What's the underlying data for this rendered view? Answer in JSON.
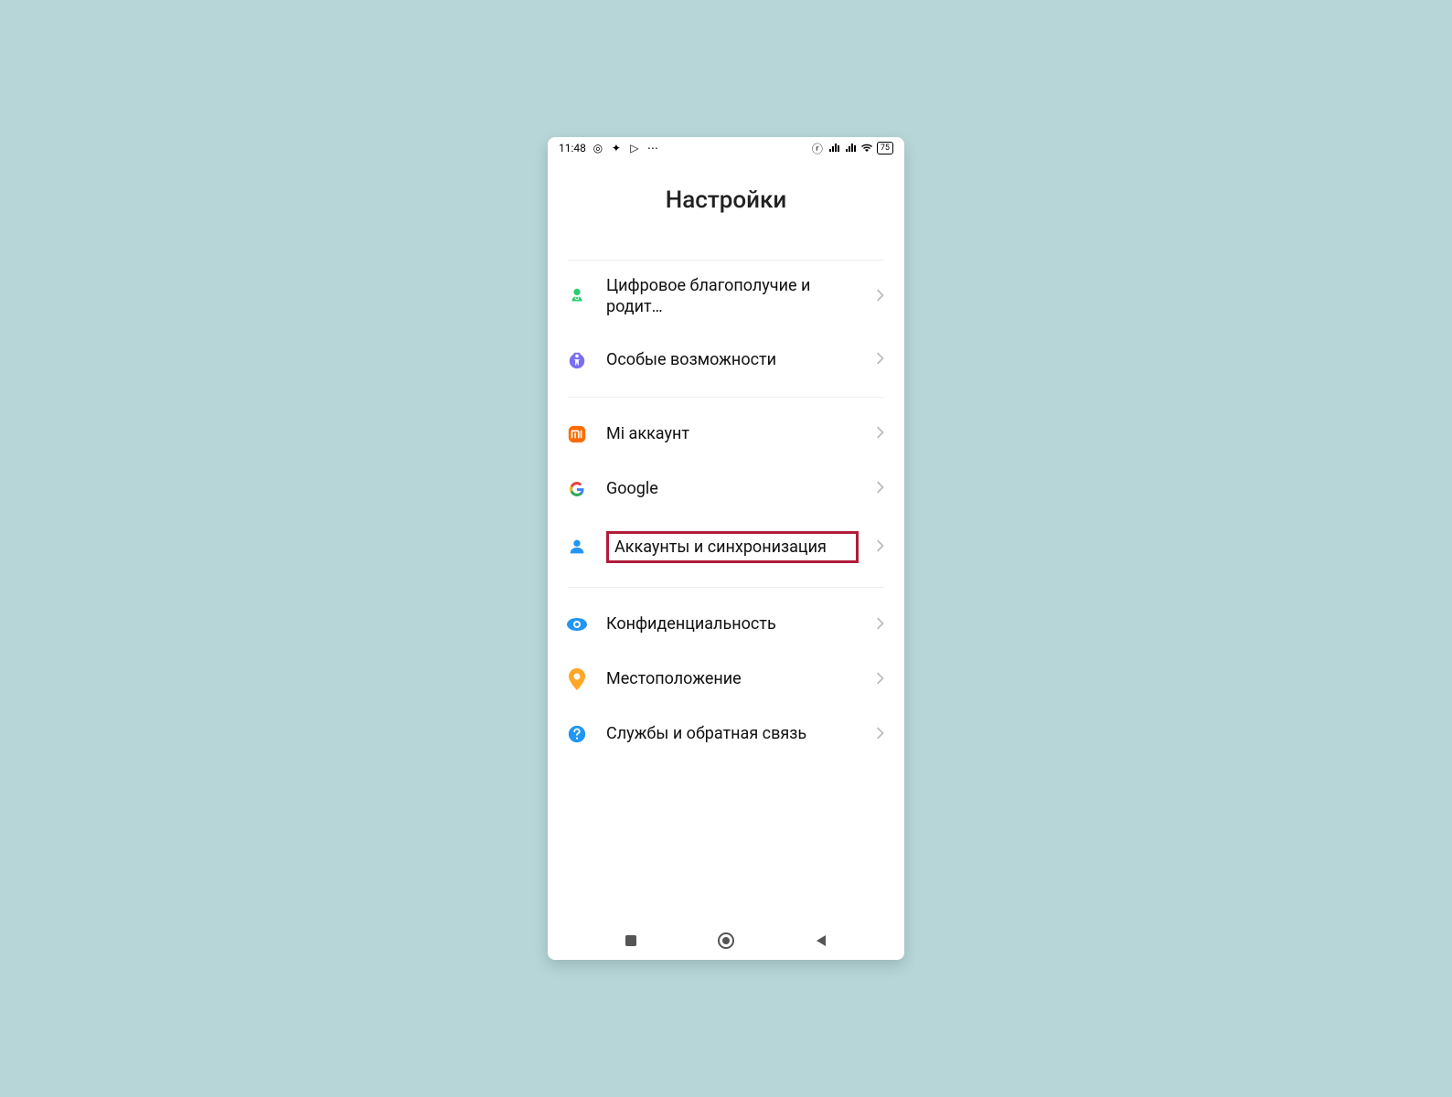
{
  "status": {
    "time": "11:48",
    "battery": "75"
  },
  "title": "Настройки",
  "groups": [
    {
      "items": [
        {
          "id": "wellbeing",
          "label": "Цифровое благополучие и родит…",
          "icon": "wellbeing"
        },
        {
          "id": "accessibility",
          "label": "Особые возможности",
          "icon": "accessibility"
        }
      ]
    },
    {
      "items": [
        {
          "id": "mi-account",
          "label": "Mi аккаунт",
          "icon": "mi"
        },
        {
          "id": "google",
          "label": "Google",
          "icon": "google"
        },
        {
          "id": "accounts-sync",
          "label": "Аккаунты и синхронизация",
          "icon": "person",
          "highlight": true
        }
      ]
    },
    {
      "items": [
        {
          "id": "privacy",
          "label": "Конфиденциальность",
          "icon": "eye"
        },
        {
          "id": "location",
          "label": "Местоположение",
          "icon": "pin"
        },
        {
          "id": "feedback",
          "label": "Службы и обратная связь",
          "icon": "help"
        }
      ]
    }
  ]
}
